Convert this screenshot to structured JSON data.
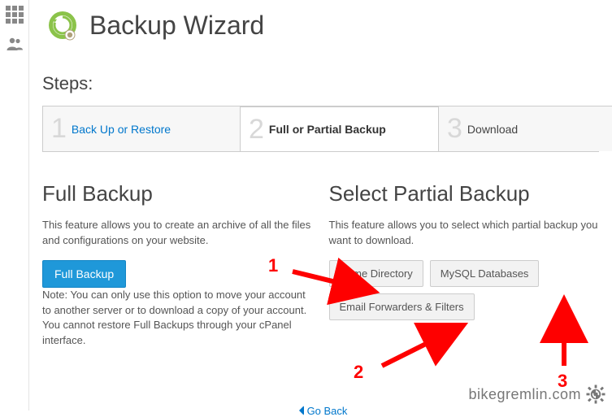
{
  "page": {
    "title": "Backup Wizard",
    "steps_heading": "Steps:",
    "go_back": "Go Back"
  },
  "steps": [
    {
      "num": "1",
      "label": "Back Up or Restore"
    },
    {
      "num": "2",
      "label": "Full or Partial Backup"
    },
    {
      "num": "3",
      "label": "Download"
    }
  ],
  "full_backup": {
    "heading": "Full Backup",
    "desc": "This feature allows you to create an archive of all the files and configurations on your website.",
    "button": "Full Backup",
    "note": "Note: You can only use this option to move your account to another server or to download a copy of your account. You cannot restore Full Backups through your cPanel interface."
  },
  "partial_backup": {
    "heading": "Select Partial Backup",
    "desc": "This feature allows you to select which partial backup you want to download.",
    "buttons": {
      "home": "Home Directory",
      "mysql": "MySQL Databases",
      "email": "Email Forwarders & Filters"
    }
  },
  "annotations": {
    "n1": "1",
    "n2": "2",
    "n3": "3"
  },
  "watermark": {
    "text": "bikegremlin.com"
  }
}
